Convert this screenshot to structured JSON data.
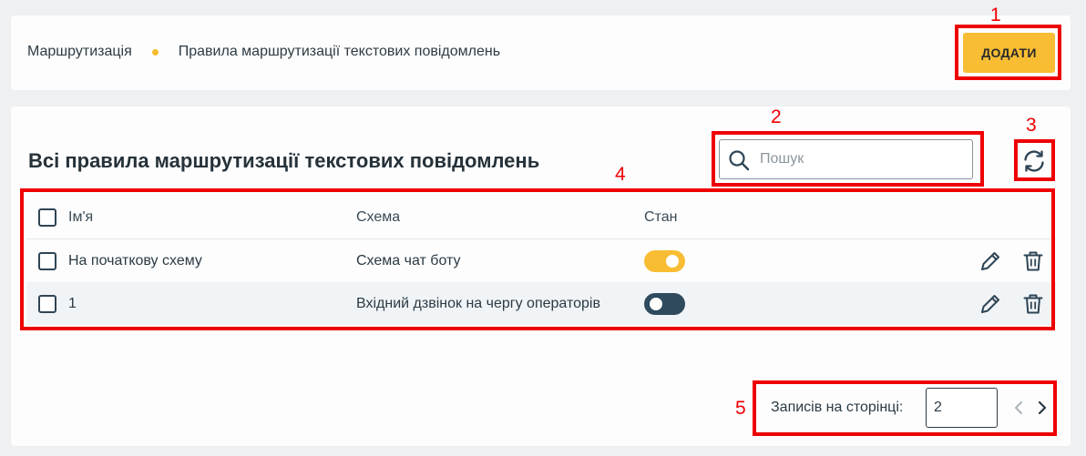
{
  "breadcrumb": {
    "items": [
      "Маршрутизація",
      "Правила маршрутизації текстових повідомлень"
    ]
  },
  "toolbar": {
    "add_label": "ДОДАТИ"
  },
  "section": {
    "title": "Всі правила маршрутизації текстових повідомлень"
  },
  "search": {
    "placeholder": "Пошук",
    "value": ""
  },
  "table": {
    "columns": [
      "Ім'я",
      "Схема",
      "Стан"
    ],
    "rows": [
      {
        "name": "На початкову схему",
        "schema": "Схема чат боту",
        "enabled": true
      },
      {
        "name": "1",
        "schema": "Вхідний дзвінок на чергу операторів",
        "enabled": false
      }
    ]
  },
  "pagination": {
    "label": "Записів на сторінці:",
    "per_page": "2"
  },
  "annotations": [
    "1",
    "2",
    "3",
    "4",
    "5"
  ],
  "colors": {
    "accent": "#f8bd32",
    "toggle_off": "#2e4a5c",
    "annotation": "#ee0000"
  },
  "icons": [
    "search-icon",
    "refresh-icon",
    "edit-icon",
    "delete-icon",
    "chevron-left-icon",
    "chevron-right-icon"
  ]
}
